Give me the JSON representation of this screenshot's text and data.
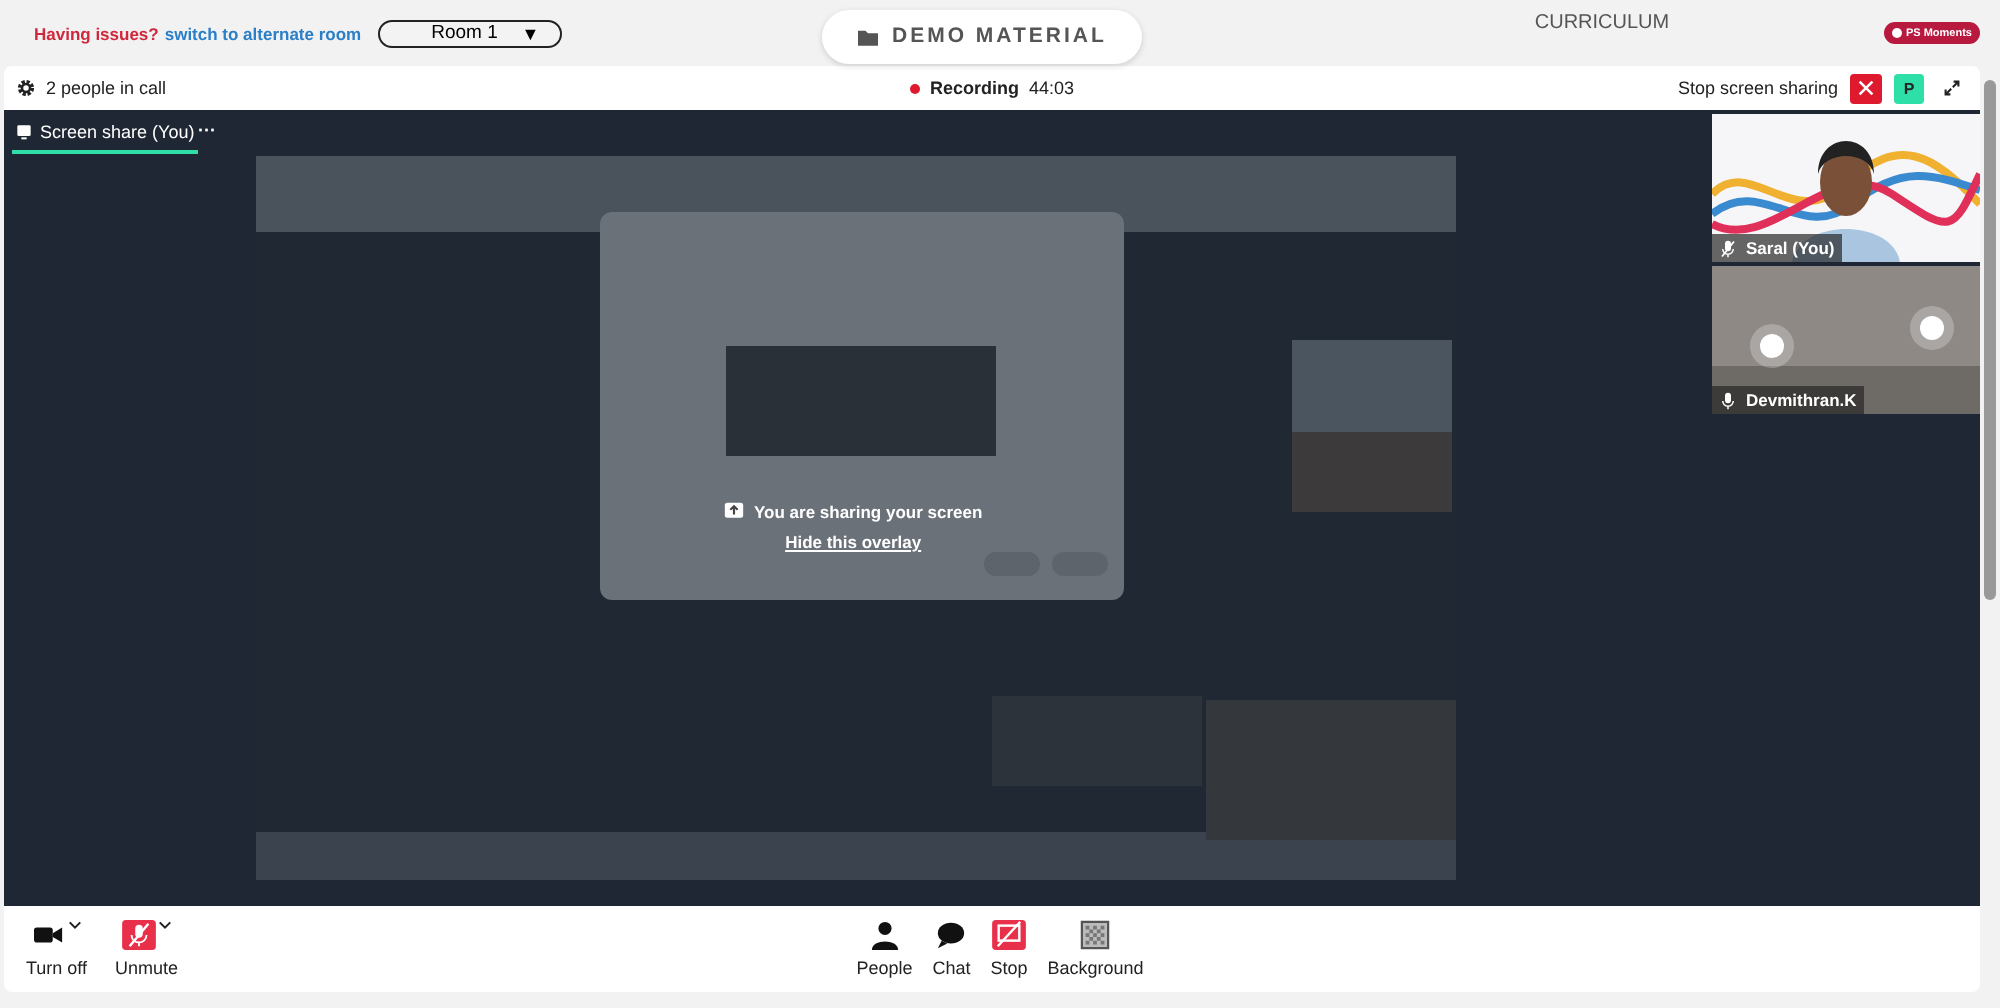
{
  "top_bar": {
    "issue_label": "Having issues?",
    "alternate_link": "switch to alternate room",
    "room_select": {
      "value": "Room 1",
      "caret": "▼"
    },
    "demo_button": "DEMO MATERIAL",
    "curriculum_link": "CURRICULUM",
    "moments_badge": "PS Moments"
  },
  "call_header": {
    "participants": "2 people in call",
    "recording": {
      "label": "Recording",
      "time": "44:03"
    },
    "stop_sharing_label": "Stop screen sharing",
    "avatar_letter": "P"
  },
  "stage_tab": {
    "label": "Screen share (You)",
    "menu": "···",
    "selected": true
  },
  "share_overlay": {
    "message": "You are sharing your screen",
    "link": "Hide this overlay"
  },
  "participants": [
    {
      "name": "Saral (You)",
      "muted": true
    },
    {
      "name": "Devmithran.K",
      "muted": false
    }
  ],
  "toolbar": [
    {
      "kind": "camera",
      "label": "Turn off",
      "caret": true
    },
    {
      "kind": "mic",
      "label": "Unmute",
      "caret": true
    },
    {
      "kind": "people",
      "label": "People",
      "caret": false
    },
    {
      "kind": "chat",
      "label": "Chat",
      "caret": false
    },
    {
      "kind": "share",
      "label": "Stop",
      "caret": false
    },
    {
      "kind": "background",
      "label": "Background",
      "caret": false
    }
  ]
}
